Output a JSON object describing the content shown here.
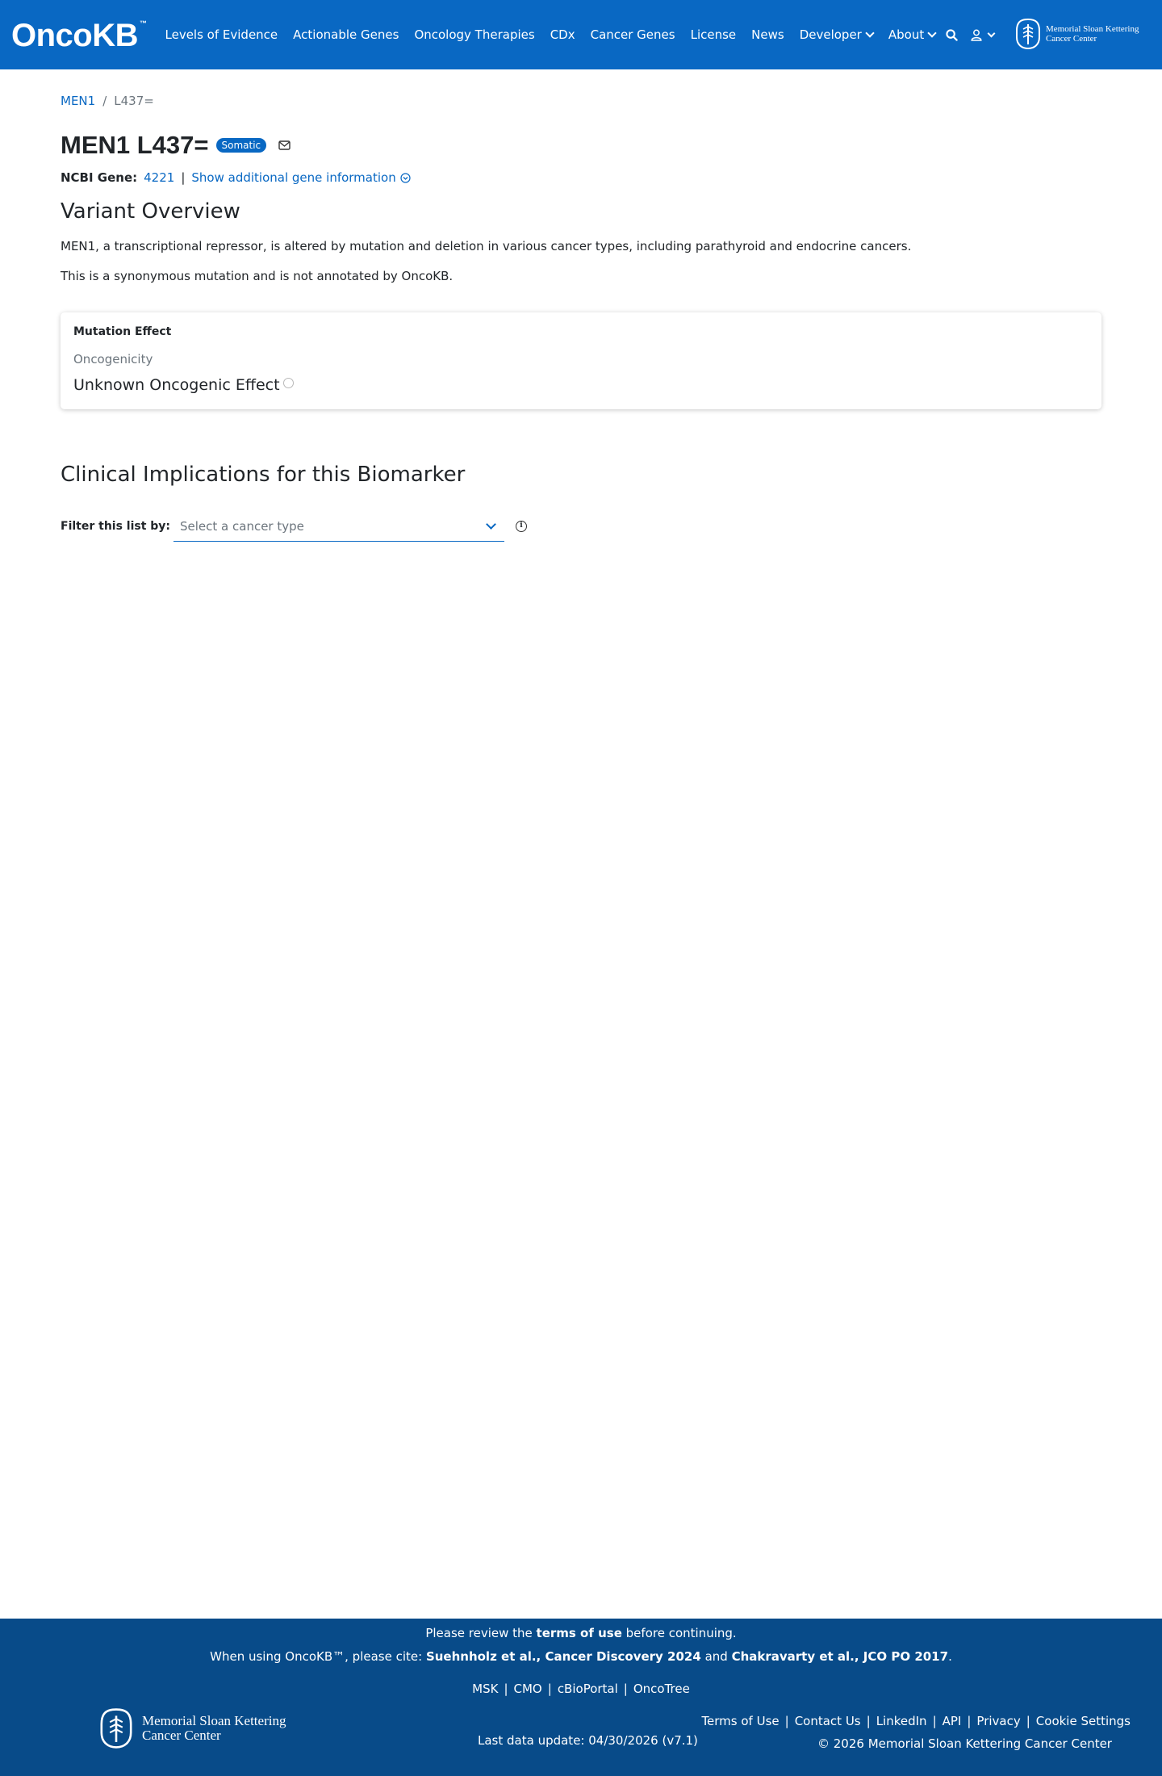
{
  "header": {
    "logo": "OncoKB",
    "logo_tm": "™",
    "nav": [
      "Levels of Evidence",
      "Actionable Genes",
      "Oncology Therapies",
      "CDx",
      "Cancer Genes",
      "License",
      "News",
      "Developer",
      "About"
    ],
    "msk_line1": "Memorial Sloan Kettering",
    "msk_line2": "Cancer Center"
  },
  "breadcrumb": {
    "gene": "MEN1",
    "separator": "/",
    "variant": "L437="
  },
  "title": "MEN1 L437=",
  "badge": "Somatic",
  "ncbi": {
    "label": "NCBI Gene:",
    "id": "4221",
    "pipe": "|",
    "more": "Show additional gene information"
  },
  "overview": {
    "heading": "Variant Overview",
    "summary": "MEN1, a transcriptional repressor, is altered by mutation and deletion in various cancer types, including parathyroid and endocrine cancers.",
    "note": "This is a synonymous mutation and is not annotated by OncoKB."
  },
  "mutation_effect": {
    "title": "Mutation Effect",
    "subtitle": "Oncogenicity",
    "value": "Unknown Oncogenic Effect"
  },
  "clinical": {
    "heading": "Clinical Implications for this Biomarker",
    "filter_label": "Filter this list by:",
    "filter_placeholder": "Select a cancer type"
  },
  "footer": {
    "review_pre": "Please review the ",
    "review_link": "terms of use",
    "review_post": " before continuing.",
    "cite_pre": "When using OncoKB™, please cite: ",
    "cite_ref1": "Suehnholz et al., Cancer Discovery 2024",
    "cite_and": " and ",
    "cite_ref2": "Chakravarty et al., JCO PO 2017",
    "cite_end": ".",
    "links": [
      "MSK",
      "CMO",
      "cBioPortal",
      "OncoTree"
    ],
    "msk_line1": "Memorial Sloan Kettering",
    "msk_line2": "Cancer Center",
    "last_update": "Last data update: 04/30/2026 (v7.1)",
    "right_links": [
      "Terms of Use",
      "Contact Us",
      "LinkedIn",
      "API",
      "Privacy",
      "Cookie Settings"
    ],
    "copyright": "© 2026 Memorial Sloan Kettering Cancer Center"
  }
}
